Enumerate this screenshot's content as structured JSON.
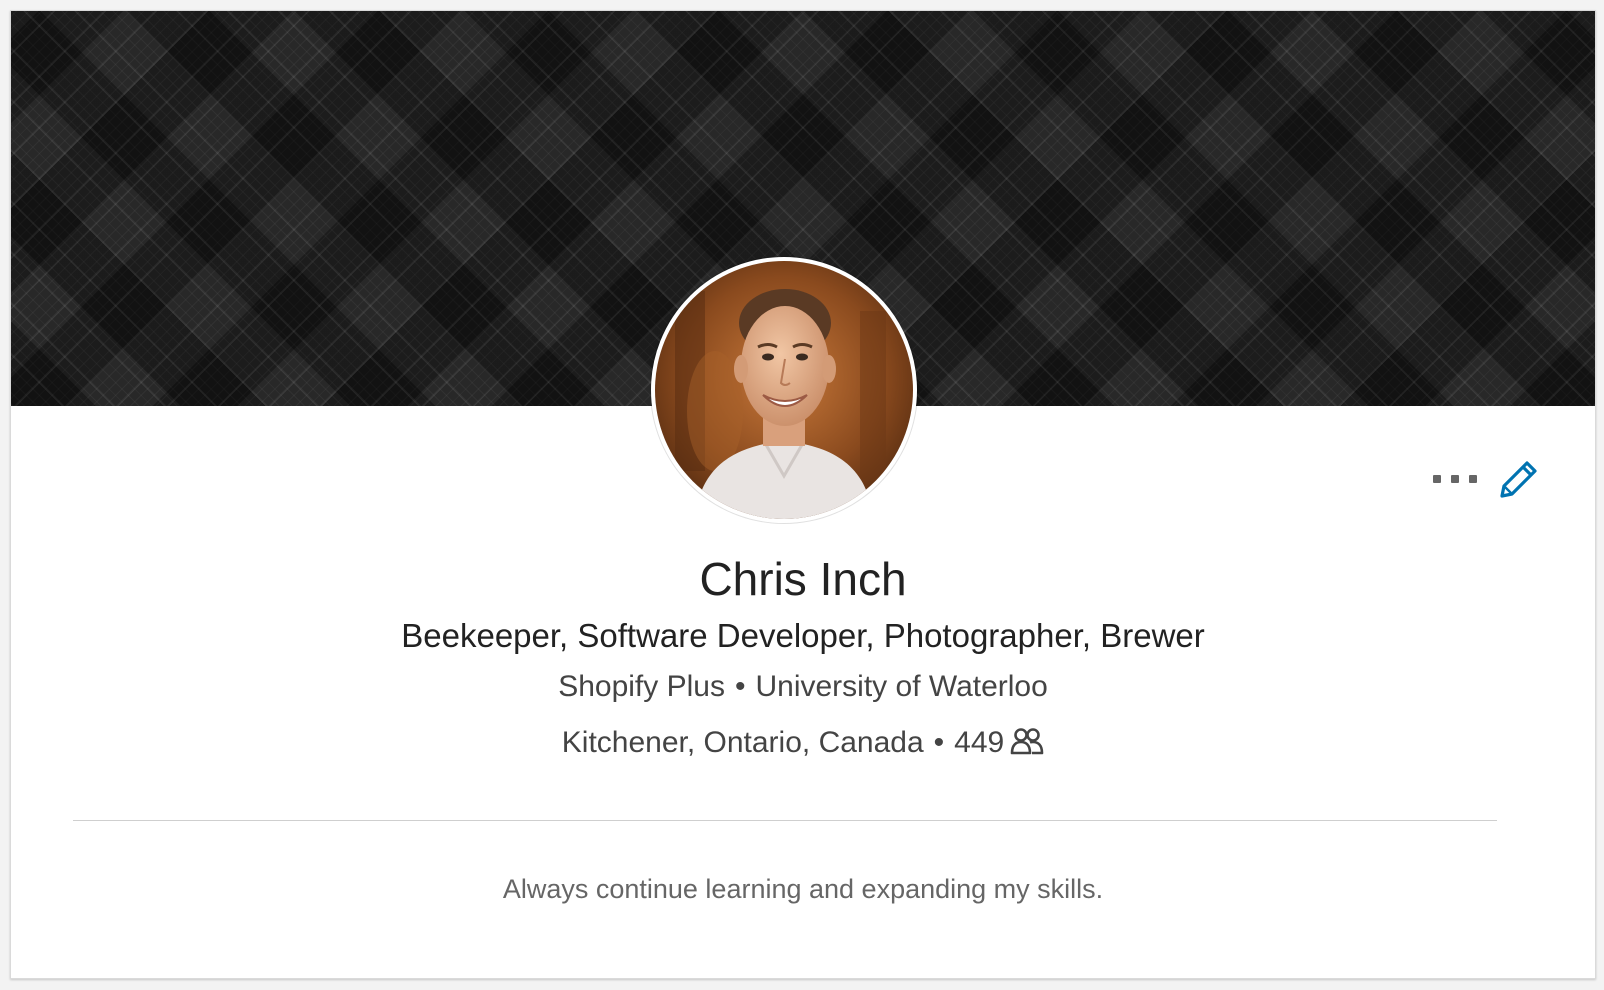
{
  "profile": {
    "name": "Chris Inch",
    "headline": "Beekeeper, Software Developer, Photographer, Brewer",
    "company": "Shopify Plus",
    "separator": "•",
    "school": "University of Waterloo",
    "location": "Kitchener, Ontario, Canada",
    "connections": "449",
    "summary": "Always continue learning and expanding my skills."
  },
  "icons": {
    "more": "more-horizontal-icon",
    "edit": "pencil-icon",
    "connections": "people-icon"
  },
  "colors": {
    "accent": "#0073b1",
    "text_primary": "#222222",
    "text_secondary": "#444444",
    "text_muted": "#666666"
  }
}
